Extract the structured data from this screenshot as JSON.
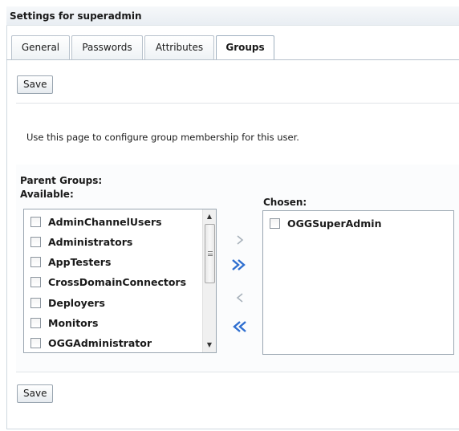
{
  "page": {
    "title": "Settings for superadmin"
  },
  "tabs": [
    {
      "label": "General",
      "active": false
    },
    {
      "label": "Passwords",
      "active": false
    },
    {
      "label": "Attributes",
      "active": false
    },
    {
      "label": "Groups",
      "active": true
    }
  ],
  "toolbar": {
    "save_label": "Save",
    "save_bottom_label": "Save"
  },
  "description": "Use this page to configure group membership for this user.",
  "groups": {
    "section_label": "Parent Groups:",
    "available_label": "Available:",
    "chosen_label": "Chosen:",
    "available": [
      {
        "label": "AdminChannelUsers",
        "checked": false
      },
      {
        "label": "Administrators",
        "checked": false
      },
      {
        "label": "AppTesters",
        "checked": false
      },
      {
        "label": "CrossDomainConnectors",
        "checked": false
      },
      {
        "label": "Deployers",
        "checked": false
      },
      {
        "label": "Monitors",
        "checked": false
      },
      {
        "label": "OGGAdministrator",
        "checked": false
      }
    ],
    "chosen": [
      {
        "label": "OGGSuperAdmin",
        "checked": false
      }
    ],
    "shuttle": {
      "move": "move-right-icon",
      "move_all": "move-all-right-icon",
      "remove": "move-left-icon",
      "remove_all": "move-all-left-icon"
    }
  },
  "colors": {
    "accent": "#2f6fd0",
    "accent_disabled": "#a8b2bb"
  }
}
